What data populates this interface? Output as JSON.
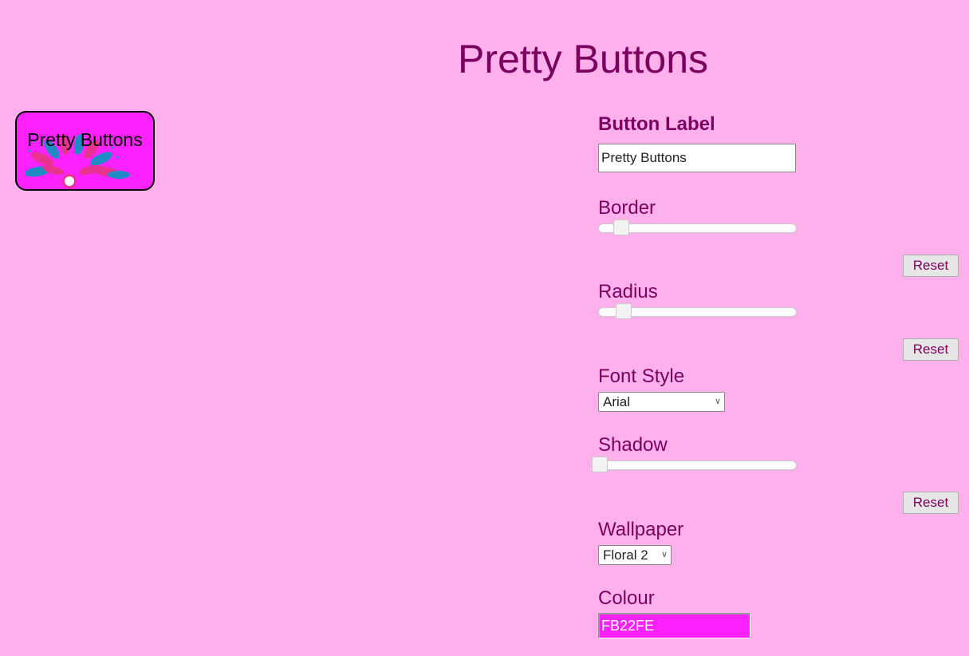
{
  "title": "Pretty Buttons",
  "preview": {
    "label": "Pretty Buttons",
    "background_color": "#FB22FE",
    "wallpaper_icon": "floral-pattern"
  },
  "controls": {
    "button_label": {
      "heading": "Button Label",
      "value": "Pretty Buttons"
    },
    "border": {
      "heading": "Border",
      "reset_label": "Reset",
      "level": 0.12
    },
    "radius": {
      "heading": "Radius",
      "reset_label": "Reset",
      "level": 0.13
    },
    "font_style": {
      "heading": "Font Style",
      "selected": "Arial"
    },
    "shadow": {
      "heading": "Shadow",
      "reset_label": "Reset",
      "level": 0.0
    },
    "wallpaper": {
      "heading": "Wallpaper",
      "selected": "Floral 2"
    },
    "colour": {
      "heading": "Colour",
      "value": "FB22FE"
    }
  },
  "colors": {
    "page_background": "#FEB0EC",
    "heading_text": "#7A0060",
    "accent": "#FB22FE"
  }
}
